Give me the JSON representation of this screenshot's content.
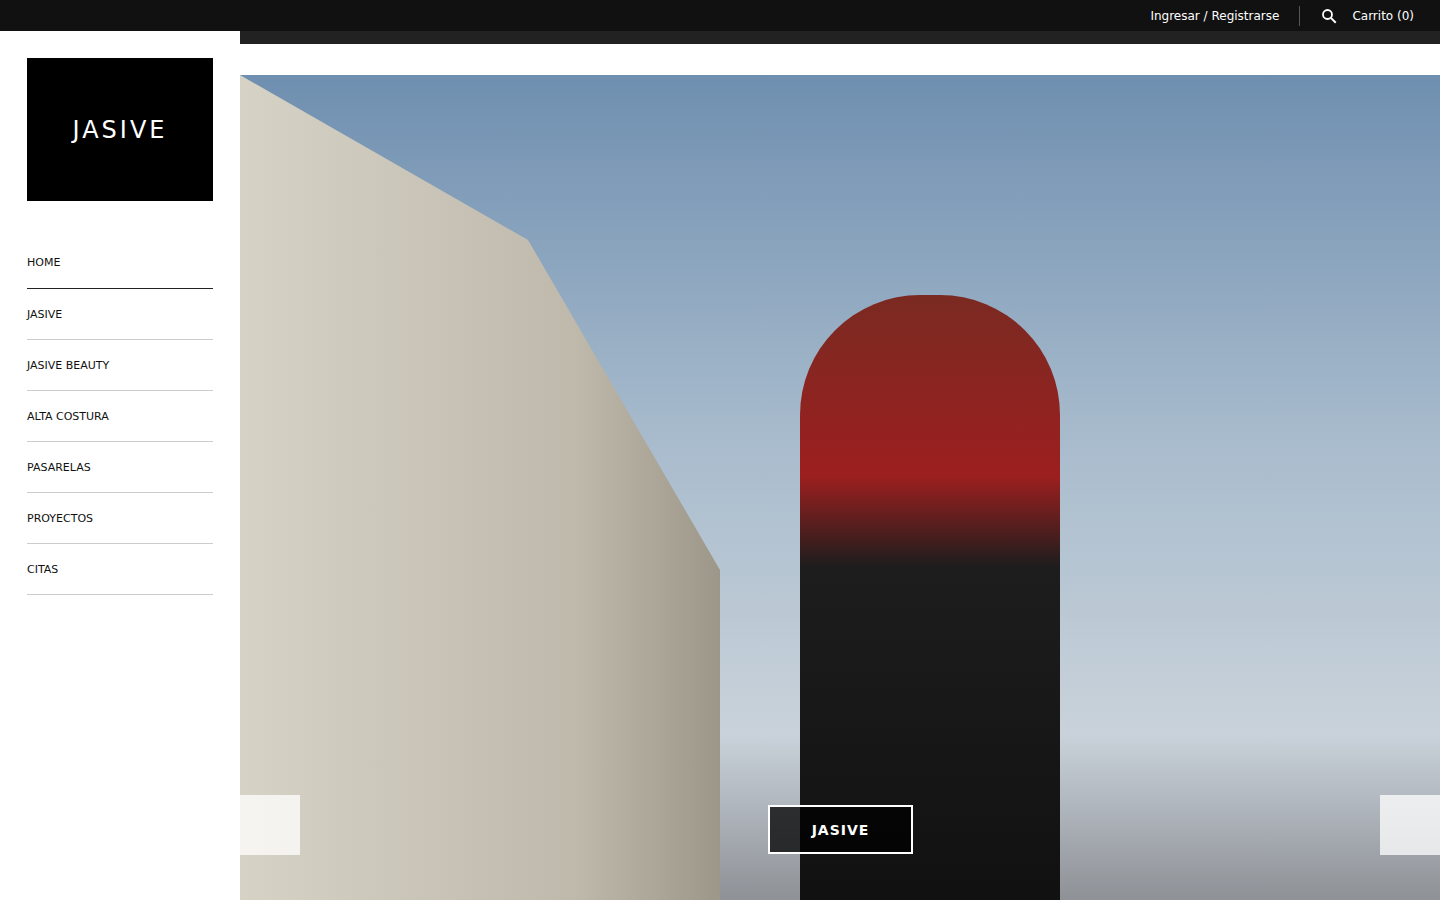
{
  "top_bar": {
    "login": "Ingresar / Registrarse",
    "cart": "Carrito (0)"
  },
  "logo": "JASIVE",
  "nav": {
    "items": [
      {
        "label": "HOME",
        "selected": true
      },
      {
        "label": "JASIVE",
        "selected": false
      },
      {
        "label": "JASIVE BEAUTY",
        "selected": false
      },
      {
        "label": "ALTA COSTURA",
        "selected": false
      },
      {
        "label": "PASARELAS",
        "selected": false
      },
      {
        "label": "PROYECTOS",
        "selected": false
      },
      {
        "label": "CITAS",
        "selected": false
      }
    ]
  },
  "hero": {
    "button": "JASIVE"
  }
}
